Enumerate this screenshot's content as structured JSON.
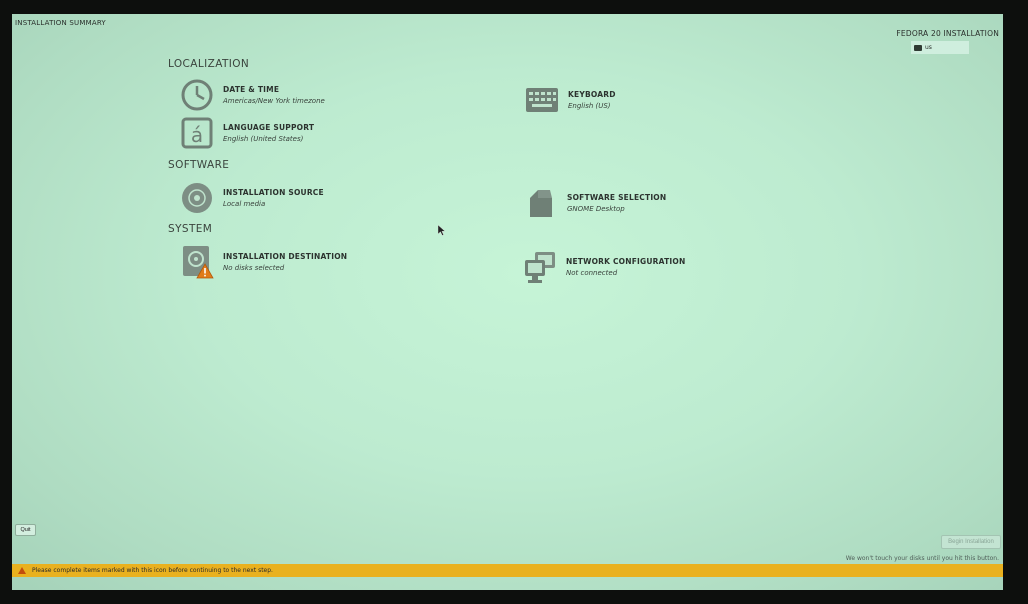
{
  "header": {
    "left_title": "INSTALLATION SUMMARY",
    "right_title": "FEDORA 20 INSTALLATION",
    "keyboard_layout": "us"
  },
  "sections": {
    "localization": "LOCALIZATION",
    "software": "SOFTWARE",
    "system": "SYSTEM"
  },
  "spokes": {
    "date_time": {
      "title": "DATE & TIME",
      "status": "Americas/New York timezone",
      "icon": "clock-icon"
    },
    "keyboard": {
      "title": "KEYBOARD",
      "status": "English (US)",
      "icon": "keyboard-icon"
    },
    "language": {
      "title": "LANGUAGE SUPPORT",
      "status": "English (United States)",
      "icon": "language-icon"
    },
    "install_source": {
      "title": "INSTALLATION SOURCE",
      "status": "Local media",
      "icon": "disc-icon"
    },
    "software_selection": {
      "title": "SOFTWARE SELECTION",
      "status": "GNOME Desktop",
      "icon": "package-icon"
    },
    "install_destination": {
      "title": "INSTALLATION DESTINATION",
      "status": "No disks selected",
      "icon": "harddisk-warning-icon"
    },
    "network": {
      "title": "NETWORK CONFIGURATION",
      "status": "Not connected",
      "icon": "network-icon"
    }
  },
  "buttons": {
    "quit": "Quit",
    "begin": "Begin Installation"
  },
  "footer": {
    "note": "We won't touch your disks until you hit this button.",
    "warning": "Please complete items marked with this icon before continuing to the next step."
  },
  "colors": {
    "background": "#bdebd0",
    "warning_bar": "#e9b11f",
    "warning_icon": "#e07b1a",
    "text": "#2c332f"
  }
}
